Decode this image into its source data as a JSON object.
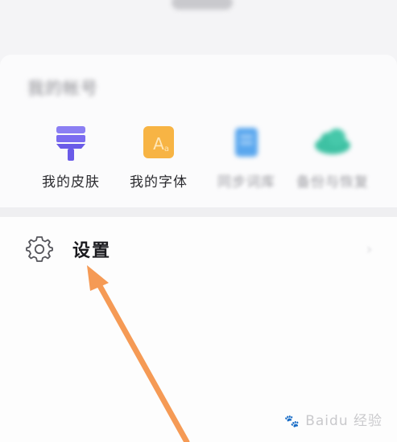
{
  "account": {
    "title": "我的帐号"
  },
  "tools": [
    {
      "label": "我的皮肤",
      "icon": "brush-icon",
      "color": "#7b6cf0"
    },
    {
      "label": "我的字体",
      "icon": "font-icon",
      "color": "#f7b444"
    },
    {
      "label": "同步词库",
      "icon": "sync-dict-icon",
      "color": "#5aa7ee"
    },
    {
      "label": "备份与恢复",
      "icon": "cloud-icon",
      "color": "#3ec1a3"
    }
  ],
  "settings": {
    "label": "设置",
    "icon": "gear-icon",
    "chevron": "›"
  },
  "annotation": {
    "color": "#f59a55"
  },
  "watermark": {
    "text": "Baidu 经验"
  }
}
